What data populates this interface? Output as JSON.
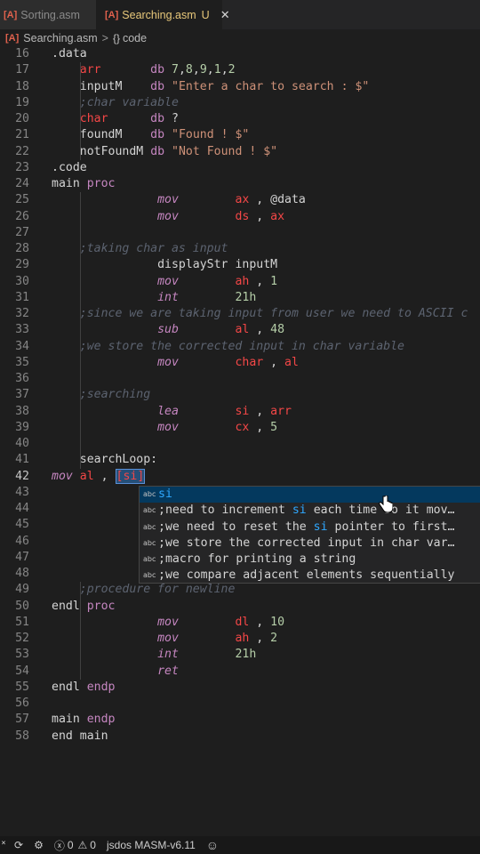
{
  "tabs": [
    {
      "label": "Sorting.asm",
      "active": false
    },
    {
      "label": "Searching.asm",
      "active": true,
      "status": "U",
      "close": "✕"
    }
  ],
  "breadcrumb": {
    "file": "Searching.asm",
    "separator": ">",
    "symbol": "code"
  },
  "editor": {
    "current_line": "42",
    "lines": [
      {
        "n": "16",
        "t": ".data"
      },
      {
        "n": "17",
        "t": "    arr       db 7,8,9,1,2"
      },
      {
        "n": "18",
        "t": "    inputM    db \"Enter a char to search : $\""
      },
      {
        "n": "19",
        "t": "    ;char variable"
      },
      {
        "n": "20",
        "t": "    char      db ?"
      },
      {
        "n": "21",
        "t": "    foundM    db \"Found ! $\""
      },
      {
        "n": "22",
        "t": "    notFoundM db \"Not Found ! $\""
      },
      {
        "n": "23",
        "t": ".code"
      },
      {
        "n": "24",
        "t": "main proc"
      },
      {
        "n": "25",
        "t": "               mov        ax , @data"
      },
      {
        "n": "26",
        "t": "               mov        ds , ax"
      },
      {
        "n": "27",
        "t": ""
      },
      {
        "n": "28",
        "t": "    ;taking char as input"
      },
      {
        "n": "29",
        "t": "               displayStr inputM"
      },
      {
        "n": "30",
        "t": "               mov        ah , 1"
      },
      {
        "n": "31",
        "t": "               int        21h"
      },
      {
        "n": "32",
        "t": "    ;since we are taking input from user we need to ASCII c"
      },
      {
        "n": "33",
        "t": "               sub        al , 48"
      },
      {
        "n": "34",
        "t": "    ;we store the corrected input in char variable"
      },
      {
        "n": "35",
        "t": "               mov        char , al"
      },
      {
        "n": "36",
        "t": ""
      },
      {
        "n": "37",
        "t": "    ;searching"
      },
      {
        "n": "38",
        "t": "               lea        si , arr"
      },
      {
        "n": "39",
        "t": "               mov        cx , 5"
      },
      {
        "n": "40",
        "t": ""
      },
      {
        "n": "41",
        "t": "    searchLoop:"
      },
      {
        "n": "42",
        "t": "mov al , [si]"
      },
      {
        "n": "43",
        "t": ""
      },
      {
        "n": "44",
        "t": ""
      },
      {
        "n": "45",
        "t": ""
      },
      {
        "n": "46",
        "t": ""
      },
      {
        "n": "47",
        "t": ""
      },
      {
        "n": "48",
        "t": ""
      },
      {
        "n": "49",
        "t": "    ;procedure for newline"
      },
      {
        "n": "50",
        "t": "endl proc"
      },
      {
        "n": "51",
        "t": "               mov        dl , 10"
      },
      {
        "n": "52",
        "t": "               mov        ah , 2"
      },
      {
        "n": "53",
        "t": "               int        21h"
      },
      {
        "n": "54",
        "t": "               ret"
      },
      {
        "n": "55",
        "t": "endl endp"
      },
      {
        "n": "56",
        "t": ""
      },
      {
        "n": "57",
        "t": "main endp"
      },
      {
        "n": "58",
        "t": "end main"
      }
    ]
  },
  "suggestions": {
    "icon_label": "abc",
    "items": [
      {
        "text": "si",
        "selected": true
      },
      {
        "text": ";need to increment si each time so it mov…",
        "selected": false
      },
      {
        "text": ";we need to reset the si pointer to first…",
        "selected": false
      },
      {
        "text": ";we store the corrected input in char var…",
        "selected": false
      },
      {
        "text": ";macro for printing a string",
        "selected": false
      },
      {
        "text": ";we compare adjacent elements sequentially",
        "selected": false
      }
    ]
  },
  "statusbar": {
    "errors": "0",
    "warnings": "0",
    "extension": "jsdos MASM-v6.11"
  },
  "colors": {
    "background": "#1e1e1e",
    "keyword": "#c586c0",
    "register": "#f44747",
    "string": "#ce9178",
    "number": "#b5cea8",
    "comment": "#5c6370",
    "match_highlight": "#2fa8ff"
  }
}
